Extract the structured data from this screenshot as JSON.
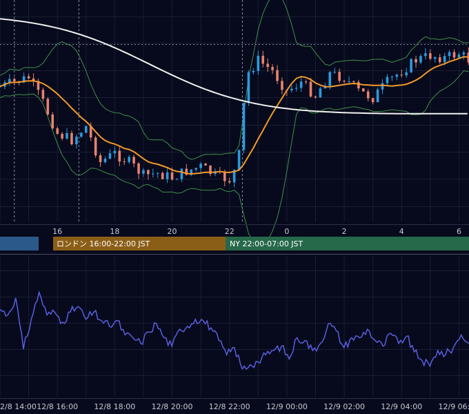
{
  "chart_data": [
    {
      "type": "candlestick",
      "title": "",
      "x_axis_hour_labels": [
        "16",
        "18",
        "20",
        "22",
        "0",
        "2",
        "4",
        "6"
      ],
      "x_range_hours": [
        14.0,
        30.35
      ],
      "y_range": [
        0,
        1
      ],
      "grid": true,
      "candles_per_hour": 6,
      "indicators": [
        {
          "name": "long moving average",
          "color": "#f2f2f2",
          "shape": "descending S-curve, high at start, flattening near middle-right"
        },
        {
          "name": "short moving average",
          "color": "#f39a2b"
        },
        {
          "name": "bollinger bands",
          "color": "#3f8f4f"
        }
      ],
      "candle_colors": {
        "up": "#2b9be0",
        "down": "#e8826e"
      },
      "horizontal_dotted_level": "upper dotted line near top",
      "vertical_dotted_hours": [
        14.5,
        16.75,
        22.45
      ],
      "price_path": [
        {
          "h": 14.0,
          "v": 0.39
        },
        {
          "h": 14.5,
          "v": 0.37
        },
        {
          "h": 15.0,
          "v": 0.35
        },
        {
          "h": 15.5,
          "v": 0.46
        },
        {
          "h": 16.0,
          "v": 0.6
        },
        {
          "h": 16.5,
          "v": 0.63
        },
        {
          "h": 17.0,
          "v": 0.57
        },
        {
          "h": 17.5,
          "v": 0.73
        },
        {
          "h": 18.0,
          "v": 0.69
        },
        {
          "h": 18.5,
          "v": 0.73
        },
        {
          "h": 19.0,
          "v": 0.79
        },
        {
          "h": 19.5,
          "v": 0.78
        },
        {
          "h": 20.0,
          "v": 0.8
        },
        {
          "h": 20.5,
          "v": 0.77
        },
        {
          "h": 21.0,
          "v": 0.75
        },
        {
          "h": 21.5,
          "v": 0.79
        },
        {
          "h": 22.0,
          "v": 0.81
        },
        {
          "h": 22.3,
          "v": 0.74
        },
        {
          "h": 22.6,
          "v": 0.34
        },
        {
          "h": 23.0,
          "v": 0.27
        },
        {
          "h": 23.5,
          "v": 0.32
        },
        {
          "h": 24.0,
          "v": 0.41
        },
        {
          "h": 24.5,
          "v": 0.37
        },
        {
          "h": 25.0,
          "v": 0.43
        },
        {
          "h": 25.5,
          "v": 0.33
        },
        {
          "h": 26.0,
          "v": 0.35
        },
        {
          "h": 26.5,
          "v": 0.41
        },
        {
          "h": 27.0,
          "v": 0.44
        },
        {
          "h": 27.5,
          "v": 0.37
        },
        {
          "h": 28.0,
          "v": 0.32
        },
        {
          "h": 28.5,
          "v": 0.27
        },
        {
          "h": 29.0,
          "v": 0.25
        },
        {
          "h": 29.5,
          "v": 0.26
        },
        {
          "h": 30.0,
          "v": 0.24
        },
        {
          "h": 30.35,
          "v": 0.27
        }
      ]
    },
    {
      "type": "line",
      "title": "",
      "series": [
        {
          "values": [
            0.62,
            0.58,
            0.7,
            0.34,
            0.55,
            0.74,
            0.58,
            0.6,
            0.53,
            0.6,
            0.64,
            0.55,
            0.6,
            0.54,
            0.5,
            0.54,
            0.44,
            0.42,
            0.38,
            0.46,
            0.52,
            0.42,
            0.36,
            0.48,
            0.5,
            0.55,
            0.54,
            0.49,
            0.4,
            0.3,
            0.35,
            0.2,
            0.23,
            0.25,
            0.3,
            0.33,
            0.36,
            0.27,
            0.42,
            0.4,
            0.33,
            0.38,
            0.52,
            0.47,
            0.35,
            0.42,
            0.42,
            0.48,
            0.4,
            0.36,
            0.45,
            0.38,
            0.43,
            0.32,
            0.26,
            0.22,
            0.33,
            0.3,
            0.35,
            0.44,
            0.38
          ]
        }
      ],
      "x_axis_labels": [
        "2/8 14:00",
        "12/8 16:00",
        "12/8 18:00",
        "12/8 20:00",
        "12/8 22:00",
        "12/9 00:00",
        "12/9 02:00",
        "12/9 04:00",
        "12/9 06:00"
      ],
      "ylim": [
        0,
        1
      ],
      "grid": true,
      "line_color": "#5b5fe0"
    }
  ],
  "sessions": [
    {
      "label": "",
      "color": "#2b5a8a"
    },
    {
      "label": "ロンドン 16:00-22:00 JST",
      "color": "#8b5e17"
    },
    {
      "label": "NY 22:00-07:00 JST",
      "color": "#26684a"
    }
  ]
}
